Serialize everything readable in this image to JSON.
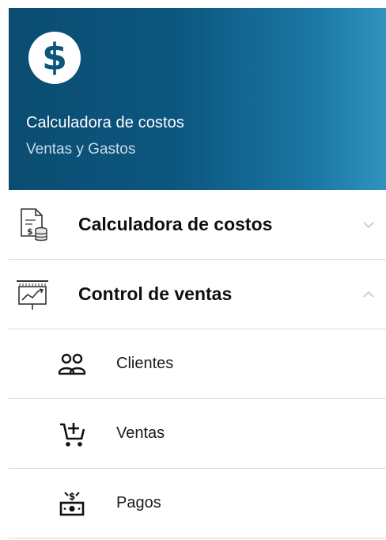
{
  "header": {
    "title": "Calculadora de costos",
    "subtitle": "Ventas y Gastos",
    "logo_icon": "dollar-circle-icon",
    "gradient_colors": [
      "#0b4c72",
      "#2f93bd"
    ]
  },
  "menu": {
    "groups": [
      {
        "label": "Calculadora de costos",
        "icon": "cost-document-coins-icon",
        "expanded": false,
        "chevron_icon": "chevron-down-icon"
      },
      {
        "label": "Control de ventas",
        "icon": "sales-chart-board-icon",
        "expanded": true,
        "chevron_icon": "chevron-up-icon",
        "items": [
          {
            "label": "Clientes",
            "icon": "people-icon"
          },
          {
            "label": "Ventas",
            "icon": "cart-add-icon"
          },
          {
            "label": "Pagos",
            "icon": "cash-payment-icon"
          }
        ]
      }
    ]
  }
}
